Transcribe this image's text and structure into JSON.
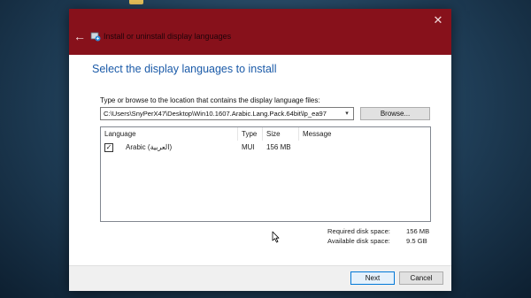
{
  "window": {
    "title": "Install or uninstall display languages",
    "back_symbol": "←",
    "close_symbol": "✕"
  },
  "page": {
    "heading": "Select the display languages to install",
    "path_label": "Type or browse to the location that contains the display language files:",
    "path_value": "C:\\Users\\SnyPerX47\\Desktop\\Win10.1607.Arabic.Lang.Pack.64bit\\lp_ea97",
    "browse_label": "Browse..."
  },
  "table": {
    "headers": [
      "Language",
      "Type",
      "Size",
      "Message"
    ],
    "rows": [
      {
        "checked": true,
        "check_symbol": "✓",
        "language": "Arabic (العربية)",
        "type": "MUI",
        "size": "156 MB",
        "message": ""
      }
    ]
  },
  "disk": {
    "required_label": "Required disk space:",
    "required_value": "156 MB",
    "available_label": "Available disk space:",
    "available_value": "9.5 GB"
  },
  "buttons": {
    "next": "Next",
    "cancel": "Cancel"
  },
  "colors": {
    "titlebar": "#87111b",
    "heading": "#1a5aa8",
    "accent": "#0078d7"
  },
  "icons": {
    "desktop_icon": "folder-icon",
    "title_icon": "language-install-icon",
    "back": "back-arrow-icon",
    "close": "close-icon",
    "combo": "chevron-down-icon",
    "cursor": "mouse-cursor-icon"
  }
}
